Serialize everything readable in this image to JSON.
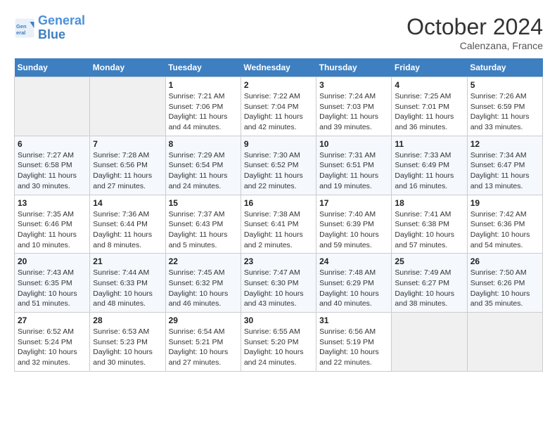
{
  "header": {
    "logo_text_general": "General",
    "logo_text_blue": "Blue",
    "month": "October 2024",
    "location": "Calenzana, France"
  },
  "weekdays": [
    "Sunday",
    "Monday",
    "Tuesday",
    "Wednesday",
    "Thursday",
    "Friday",
    "Saturday"
  ],
  "weeks": [
    [
      {
        "day": null
      },
      {
        "day": null
      },
      {
        "day": "1",
        "sunrise": "7:21 AM",
        "sunset": "7:06 PM",
        "daylight": "11 hours and 44 minutes."
      },
      {
        "day": "2",
        "sunrise": "7:22 AM",
        "sunset": "7:04 PM",
        "daylight": "11 hours and 42 minutes."
      },
      {
        "day": "3",
        "sunrise": "7:24 AM",
        "sunset": "7:03 PM",
        "daylight": "11 hours and 39 minutes."
      },
      {
        "day": "4",
        "sunrise": "7:25 AM",
        "sunset": "7:01 PM",
        "daylight": "11 hours and 36 minutes."
      },
      {
        "day": "5",
        "sunrise": "7:26 AM",
        "sunset": "6:59 PM",
        "daylight": "11 hours and 33 minutes."
      }
    ],
    [
      {
        "day": "6",
        "sunrise": "7:27 AM",
        "sunset": "6:58 PM",
        "daylight": "11 hours and 30 minutes."
      },
      {
        "day": "7",
        "sunrise": "7:28 AM",
        "sunset": "6:56 PM",
        "daylight": "11 hours and 27 minutes."
      },
      {
        "day": "8",
        "sunrise": "7:29 AM",
        "sunset": "6:54 PM",
        "daylight": "11 hours and 24 minutes."
      },
      {
        "day": "9",
        "sunrise": "7:30 AM",
        "sunset": "6:52 PM",
        "daylight": "11 hours and 22 minutes."
      },
      {
        "day": "10",
        "sunrise": "7:31 AM",
        "sunset": "6:51 PM",
        "daylight": "11 hours and 19 minutes."
      },
      {
        "day": "11",
        "sunrise": "7:33 AM",
        "sunset": "6:49 PM",
        "daylight": "11 hours and 16 minutes."
      },
      {
        "day": "12",
        "sunrise": "7:34 AM",
        "sunset": "6:47 PM",
        "daylight": "11 hours and 13 minutes."
      }
    ],
    [
      {
        "day": "13",
        "sunrise": "7:35 AM",
        "sunset": "6:46 PM",
        "daylight": "11 hours and 10 minutes."
      },
      {
        "day": "14",
        "sunrise": "7:36 AM",
        "sunset": "6:44 PM",
        "daylight": "11 hours and 8 minutes."
      },
      {
        "day": "15",
        "sunrise": "7:37 AM",
        "sunset": "6:43 PM",
        "daylight": "11 hours and 5 minutes."
      },
      {
        "day": "16",
        "sunrise": "7:38 AM",
        "sunset": "6:41 PM",
        "daylight": "11 hours and 2 minutes."
      },
      {
        "day": "17",
        "sunrise": "7:40 AM",
        "sunset": "6:39 PM",
        "daylight": "10 hours and 59 minutes."
      },
      {
        "day": "18",
        "sunrise": "7:41 AM",
        "sunset": "6:38 PM",
        "daylight": "10 hours and 57 minutes."
      },
      {
        "day": "19",
        "sunrise": "7:42 AM",
        "sunset": "6:36 PM",
        "daylight": "10 hours and 54 minutes."
      }
    ],
    [
      {
        "day": "20",
        "sunrise": "7:43 AM",
        "sunset": "6:35 PM",
        "daylight": "10 hours and 51 minutes."
      },
      {
        "day": "21",
        "sunrise": "7:44 AM",
        "sunset": "6:33 PM",
        "daylight": "10 hours and 48 minutes."
      },
      {
        "day": "22",
        "sunrise": "7:45 AM",
        "sunset": "6:32 PM",
        "daylight": "10 hours and 46 minutes."
      },
      {
        "day": "23",
        "sunrise": "7:47 AM",
        "sunset": "6:30 PM",
        "daylight": "10 hours and 43 minutes."
      },
      {
        "day": "24",
        "sunrise": "7:48 AM",
        "sunset": "6:29 PM",
        "daylight": "10 hours and 40 minutes."
      },
      {
        "day": "25",
        "sunrise": "7:49 AM",
        "sunset": "6:27 PM",
        "daylight": "10 hours and 38 minutes."
      },
      {
        "day": "26",
        "sunrise": "7:50 AM",
        "sunset": "6:26 PM",
        "daylight": "10 hours and 35 minutes."
      }
    ],
    [
      {
        "day": "27",
        "sunrise": "6:52 AM",
        "sunset": "5:24 PM",
        "daylight": "10 hours and 32 minutes."
      },
      {
        "day": "28",
        "sunrise": "6:53 AM",
        "sunset": "5:23 PM",
        "daylight": "10 hours and 30 minutes."
      },
      {
        "day": "29",
        "sunrise": "6:54 AM",
        "sunset": "5:21 PM",
        "daylight": "10 hours and 27 minutes."
      },
      {
        "day": "30",
        "sunrise": "6:55 AM",
        "sunset": "5:20 PM",
        "daylight": "10 hours and 24 minutes."
      },
      {
        "day": "31",
        "sunrise": "6:56 AM",
        "sunset": "5:19 PM",
        "daylight": "10 hours and 22 minutes."
      },
      {
        "day": null
      },
      {
        "day": null
      }
    ]
  ]
}
